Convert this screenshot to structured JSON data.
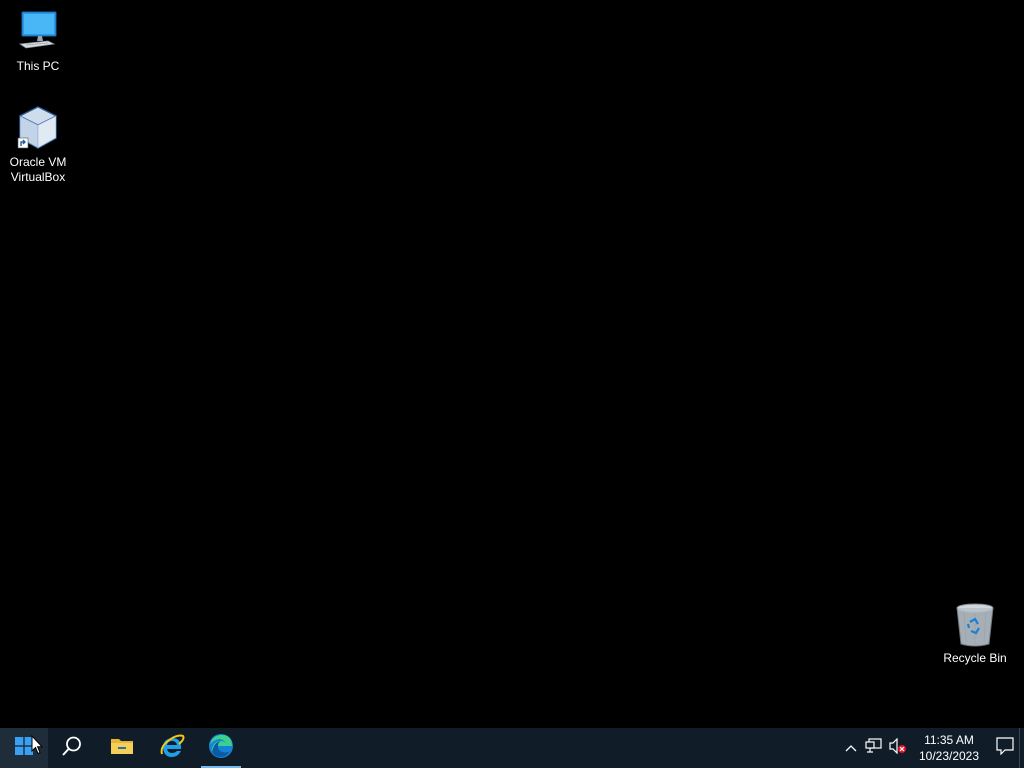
{
  "desktop": {
    "background_color": "#000000",
    "icons": [
      {
        "label": "This PC",
        "icon": "computer-icon"
      },
      {
        "label": "Oracle VM\nVirtualBox",
        "icon": "virtualbox-icon"
      },
      {
        "label": "Recycle Bin",
        "icon": "recycle-bin-icon"
      }
    ]
  },
  "taskbar": {
    "background_color": "#101c28",
    "buttons": [
      {
        "icon": "windows-logo-icon"
      },
      {
        "icon": "search-icon"
      },
      {
        "icon": "file-explorer-icon"
      },
      {
        "icon": "internet-explorer-icon"
      },
      {
        "icon": "edge-icon",
        "active": true
      }
    ],
    "tray": {
      "icons": [
        "chevron-up-icon",
        "network-icon",
        "volume-muted-icon",
        "notifications-icon"
      ],
      "time": "11:35 AM",
      "date": "10/23/2023"
    }
  }
}
